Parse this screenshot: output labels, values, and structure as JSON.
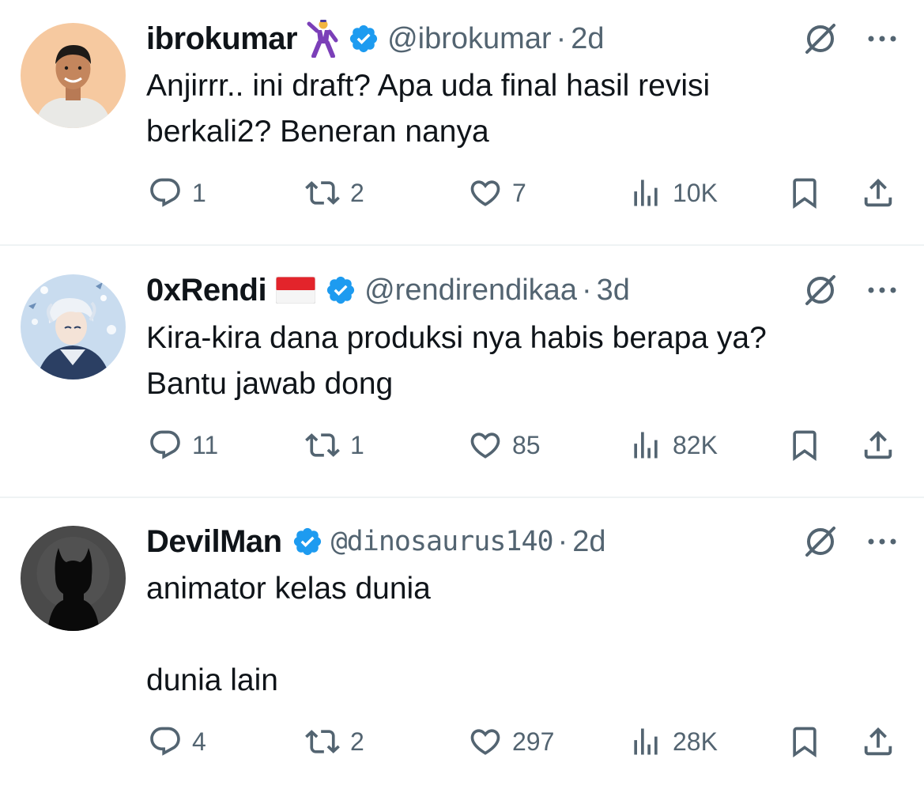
{
  "tweets": [
    {
      "name": "ibrokumar",
      "flair_icon": "dancing-man-emoji",
      "verified": true,
      "handle": "@ibrokumar",
      "time": "2d",
      "text": [
        "Anjirrr.. ini draft? Apa uda final hasil revisi",
        "berkali2? Beneran nanya"
      ],
      "replies": "1",
      "reposts": "2",
      "likes": "7",
      "views": "10K"
    },
    {
      "name": "0xRendi",
      "flair_icon": "indonesia-flag-emoji",
      "verified": true,
      "handle": "@rendirendikaa",
      "time": "3d",
      "text": [
        "Kira-kira dana produksi nya habis berapa ya?",
        "Bantu jawab dong"
      ],
      "replies": "11",
      "reposts": "1",
      "likes": "85",
      "views": "82K"
    },
    {
      "name": "DevilMan",
      "verified": true,
      "handle": "@dinosaurus140",
      "time": "2d",
      "text": [
        "animator kelas dunia",
        "",
        "dunia lain"
      ],
      "replies": "4",
      "reposts": "2",
      "likes": "297",
      "views": "28K"
    }
  ],
  "separator": "·",
  "colors": {
    "text": "#0f1419",
    "secondary": "#536471",
    "verified": "#1d9bf0",
    "divider": "#eff3f4"
  }
}
